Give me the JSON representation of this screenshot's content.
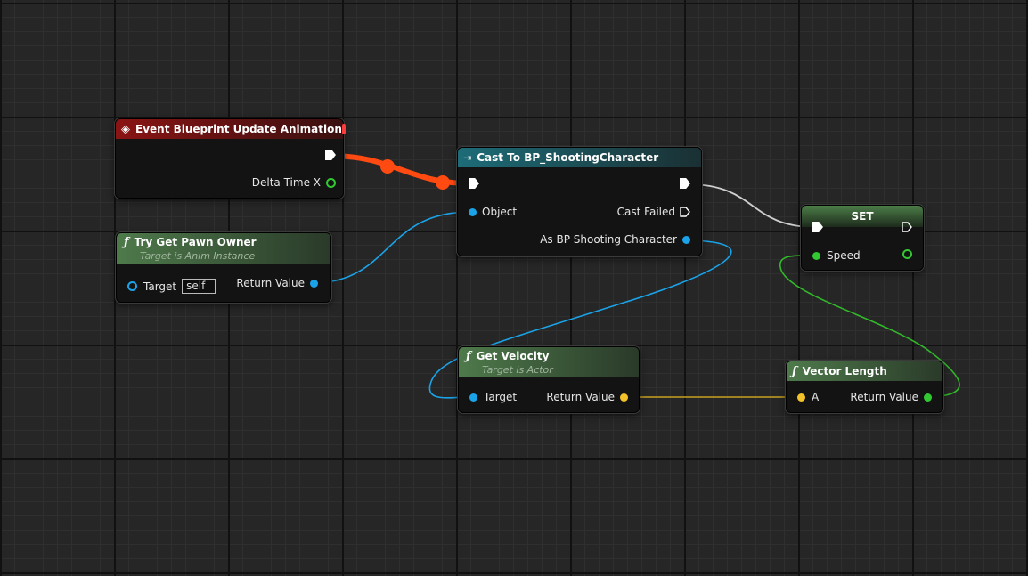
{
  "nodes": {
    "event": {
      "title": "Event Blueprint Update Animation",
      "pin_delta": "Delta Time X"
    },
    "cast": {
      "title": "Cast To BP_ShootingCharacter",
      "pin_object": "Object",
      "pin_cast_failed": "Cast Failed",
      "pin_as": "As BP Shooting Character"
    },
    "set": {
      "title": "SET",
      "pin_speed": "Speed"
    },
    "pawn_owner": {
      "title": "Try Get Pawn Owner",
      "subtitle": "Target is Anim Instance",
      "pin_target": "Target",
      "target_value": "self",
      "pin_return": "Return Value"
    },
    "velocity": {
      "title": "Get Velocity",
      "subtitle": "Target is Actor",
      "pin_target": "Target",
      "pin_return": "Return Value"
    },
    "vlength": {
      "title": "Vector Length",
      "pin_a": "A",
      "pin_return": "Return Value"
    }
  },
  "colors": {
    "exec_wire": "#ff4a12",
    "object_pin": "#1aa3e8",
    "vector_pin": "#f3c12a",
    "float_pin": "#32c832",
    "event_header": "#8a1414",
    "cast_header": "#1d6c78",
    "function_header": "#4e7a4b"
  },
  "icons": {
    "event": "event-diamond-icon",
    "cast": "cast-arrow-icon",
    "function": "function-f-icon",
    "stop": "stop-square-icon"
  }
}
